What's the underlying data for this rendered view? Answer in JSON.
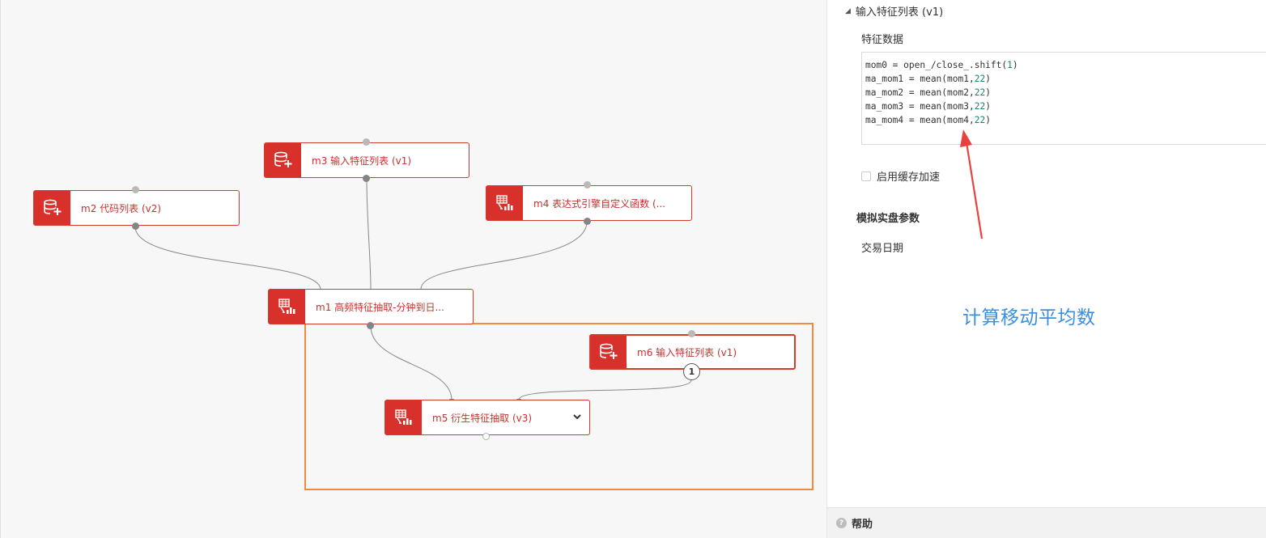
{
  "canvas": {
    "nodes": [
      {
        "id": "m3",
        "label": "m3 输入特征列表 (v1)",
        "icon": "database-plus-icon"
      },
      {
        "id": "m2",
        "label": "m2 代码列表 (v2)",
        "icon": "database-plus-icon"
      },
      {
        "id": "m4",
        "label": "m4 表达式引擎自定义函数 (...",
        "icon": "grid-chart-icon"
      },
      {
        "id": "m1",
        "label": "m1 高频特征抽取-分钟到日...",
        "icon": "grid-chart-icon"
      },
      {
        "id": "m6",
        "label": "m6 输入特征列表 (v1)",
        "icon": "database-plus-icon"
      },
      {
        "id": "m5",
        "label": "m5 衍生特征抽取 (v3)",
        "icon": "grid-chart-icon"
      }
    ],
    "port_badge": "1"
  },
  "panel": {
    "header": "输入特征列表 (v1)",
    "feature_label": "特征数据",
    "code": [
      {
        "pre": "mom0 = open_/close_.shift(",
        "num": "1",
        "post": ")"
      },
      {
        "pre": "ma_mom1 = mean(mom1,",
        "num": "22",
        "post": ")"
      },
      {
        "pre": "ma_mom2 = mean(mom2,",
        "num": "22",
        "post": ")"
      },
      {
        "pre": "ma_mom3 = mean(mom3,",
        "num": "22",
        "post": ")"
      },
      {
        "pre": "ma_mom4 = mean(mom4,",
        "num": "22",
        "post": ")"
      }
    ],
    "cache_label": "启用缓存加速",
    "section_title": "模拟实盘参数",
    "trade_date_label": "交易日期",
    "annotation": "计算移动平均数",
    "help": "帮助"
  },
  "colors": {
    "node_red": "#d8302a",
    "selection_orange": "#f08a3c",
    "annotation_red": "#e8423f",
    "annotation_blue": "#3a8fe0"
  }
}
